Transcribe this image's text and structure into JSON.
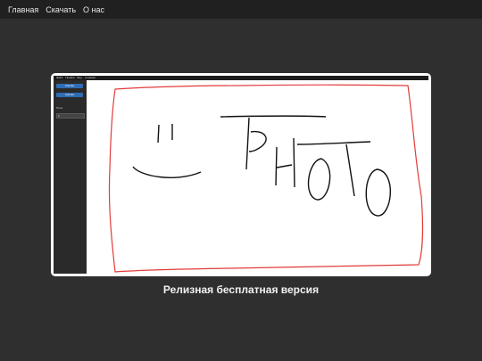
{
  "nav": {
    "items": [
      {
        "label": "Главная"
      },
      {
        "label": "Скачать"
      },
      {
        "label": "О нас"
      }
    ]
  },
  "preview": {
    "menubar": [
      "Файл",
      "Правка",
      "Вид",
      "Справка"
    ],
    "buttons": [
      {
        "label": "Кнопка"
      },
      {
        "label": "Кнопка"
      }
    ],
    "field_label": "Поле",
    "input_value": "0",
    "stroke_colors": {
      "frame": "#e23b3b",
      "ink": "#111111"
    }
  },
  "caption": "Релизная бесплатная версия"
}
